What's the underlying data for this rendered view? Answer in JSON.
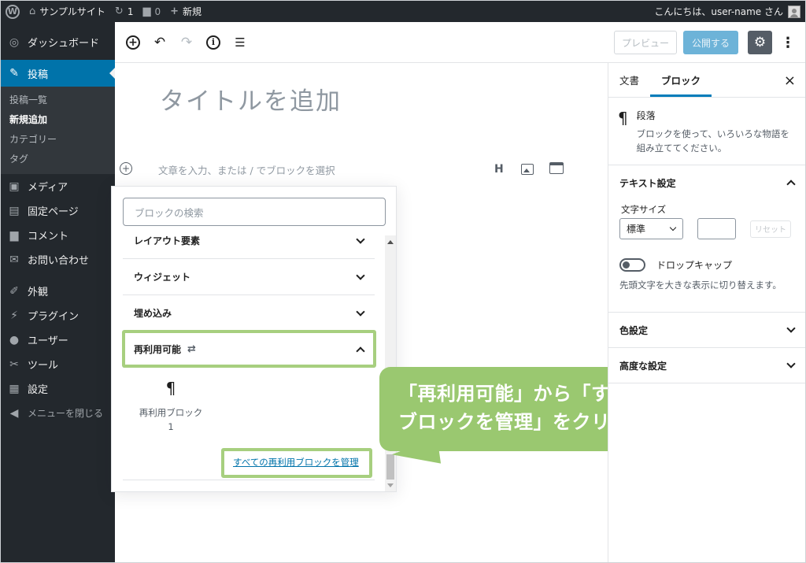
{
  "adminbar": {
    "wp_logo": "W",
    "site_name": "サンプルサイト",
    "updates_count": "1",
    "comments_count": "0",
    "new_label": "新規",
    "greeting": "こんにちは、user-name さん"
  },
  "sidebar": {
    "dashboard": "ダッシュボード",
    "posts": "投稿",
    "posts_sub": [
      "投稿一覧",
      "新規追加",
      "カテゴリー",
      "タグ"
    ],
    "media": "メディア",
    "pages": "固定ページ",
    "comments": "コメント",
    "contact": "お問い合わせ",
    "appearance": "外観",
    "plugins": "プラグイン",
    "users": "ユーザー",
    "tools": "ツール",
    "settings": "設定",
    "collapse": "メニューを閉じる"
  },
  "toolbar": {
    "preview_label": "プレビュー",
    "publish_label": "公開する"
  },
  "editor": {
    "title_placeholder": "タイトルを追加",
    "paragraph_placeholder": "文章を入力、または / でブロックを選択",
    "quick_heading": "H"
  },
  "inserter": {
    "search_placeholder": "ブロックの検索",
    "panels": [
      "レイアウト要素",
      "ウィジェット",
      "埋め込み",
      "再利用可能"
    ],
    "reusable_block_label": "再利用ブロック",
    "reusable_block_count": "1",
    "manage_link": "すべての再利用ブロックを管理"
  },
  "callout": {
    "line1": "「再利用可能」から「すべての再利用",
    "line2": "ブロックを管理」をクリック"
  },
  "settings_panel": {
    "tab_document": "文書",
    "tab_block": "ブロック",
    "block_title": "段落",
    "block_description": "ブロックを使って、いろいろな物語を組み立ててください。",
    "text_settings": "テキスト設定",
    "font_size_label": "文字サイズ",
    "font_size_value": "標準",
    "reset_label": "リセット",
    "drop_cap_label": "ドロップキャップ",
    "drop_cap_help": "先頭文字を大きな表示に切り替えます。",
    "color_settings": "色設定",
    "advanced_settings": "高度な設定"
  },
  "colors": {
    "admin_dark": "#23282d",
    "active_blue": "#0073aa",
    "highlight_green": "#a7cf7f",
    "callout_green": "#9ac870"
  }
}
